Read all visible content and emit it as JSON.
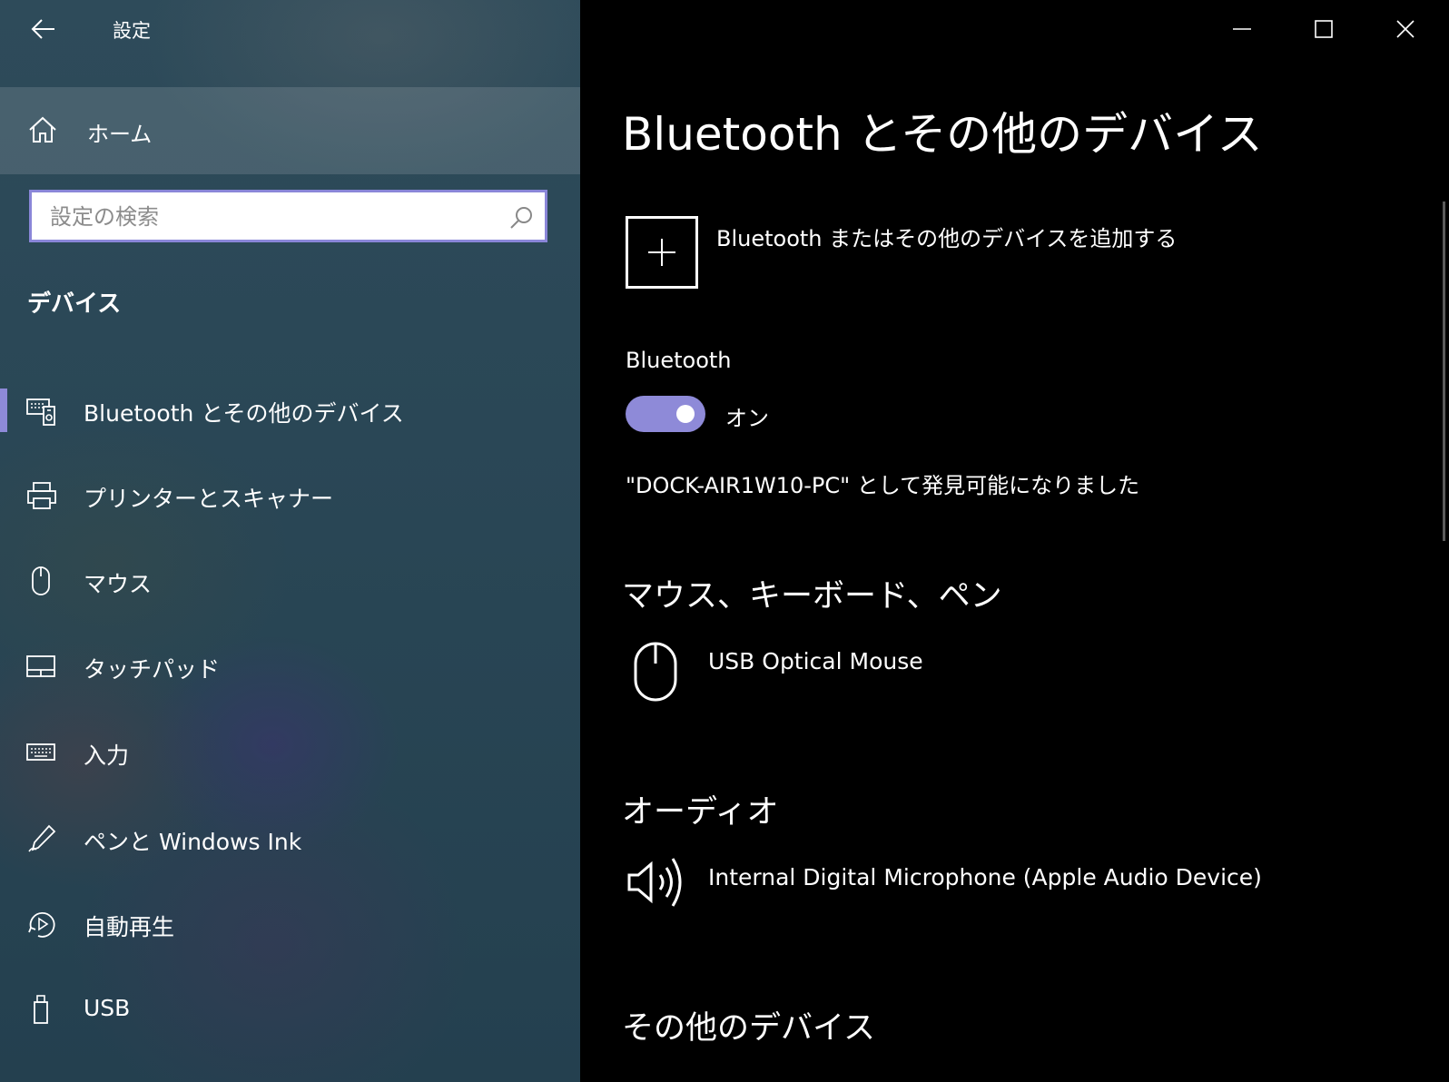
{
  "window": {
    "title": "設定",
    "controls": [
      "minimize",
      "maximize",
      "close"
    ]
  },
  "sidebar": {
    "home_label": "ホーム",
    "search": {
      "placeholder": "設定の検索",
      "value": ""
    },
    "section_title": "デバイス",
    "items": [
      {
        "label": "Bluetooth とその他のデバイス",
        "icon": "bluetooth-devices-icon",
        "selected": true
      },
      {
        "label": "プリンターとスキャナー",
        "icon": "printer-icon",
        "selected": false
      },
      {
        "label": "マウス",
        "icon": "mouse-icon",
        "selected": false
      },
      {
        "label": "タッチパッド",
        "icon": "touchpad-icon",
        "selected": false
      },
      {
        "label": "入力",
        "icon": "keyboard-icon",
        "selected": false
      },
      {
        "label": "ペンと Windows Ink",
        "icon": "pen-icon",
        "selected": false
      },
      {
        "label": "自動再生",
        "icon": "autoplay-icon",
        "selected": false
      },
      {
        "label": "USB",
        "icon": "usb-icon",
        "selected": false
      }
    ]
  },
  "main": {
    "page_title": "Bluetooth とその他のデバイス",
    "add_device_label": "Bluetooth またはその他のデバイスを追加する",
    "bluetooth": {
      "label": "Bluetooth",
      "toggle_state": "オン",
      "enabled": true,
      "discoverable_text": "\"DOCK-AIR1W10-PC\" として発見可能になりました"
    },
    "sections": [
      {
        "heading": "マウス、キーボード、ペン",
        "devices": [
          {
            "name": "USB Optical Mouse",
            "icon": "mouse-icon"
          }
        ]
      },
      {
        "heading": "オーディオ",
        "devices": [
          {
            "name": "Internal Digital Microphone (Apple Audio Device)",
            "icon": "speaker-icon"
          }
        ]
      },
      {
        "heading": "その他のデバイス",
        "devices": []
      }
    ]
  },
  "colors": {
    "accent": "#8e8ad8",
    "main_background": "#000000",
    "sidebar_background": "#2a4756"
  }
}
